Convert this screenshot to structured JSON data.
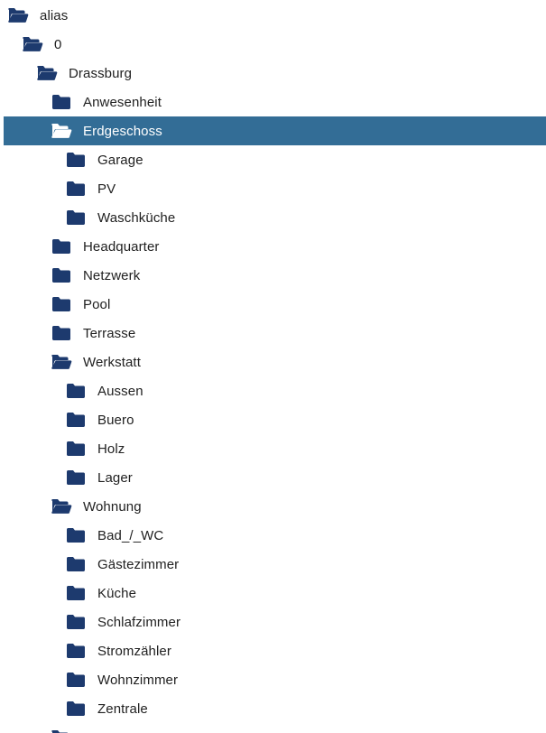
{
  "colors": {
    "folder_icon": "#1d3a6e",
    "selected_background": "#336d96",
    "selected_text": "#ffffff",
    "text": "#212121"
  },
  "tree": {
    "nodes": [
      {
        "label": "alias",
        "depth": 0,
        "state": "open",
        "icon": "folder-open-icon",
        "selected": false
      },
      {
        "label": "0",
        "depth": 1,
        "state": "open",
        "icon": "folder-open-icon",
        "selected": false
      },
      {
        "label": "Drassburg",
        "depth": 2,
        "state": "open",
        "icon": "folder-open-icon",
        "selected": false
      },
      {
        "label": "Anwesenheit",
        "depth": 3,
        "state": "closed",
        "icon": "folder-icon",
        "selected": false
      },
      {
        "label": "Erdgeschoss",
        "depth": 3,
        "state": "open",
        "icon": "folder-open-icon",
        "selected": true
      },
      {
        "label": "Garage",
        "depth": 4,
        "state": "closed",
        "icon": "folder-icon",
        "selected": false
      },
      {
        "label": "PV",
        "depth": 4,
        "state": "closed",
        "icon": "folder-icon",
        "selected": false
      },
      {
        "label": "Waschküche",
        "depth": 4,
        "state": "closed",
        "icon": "folder-icon",
        "selected": false
      },
      {
        "label": "Headquarter",
        "depth": 3,
        "state": "closed",
        "icon": "folder-icon",
        "selected": false
      },
      {
        "label": "Netzwerk",
        "depth": 3,
        "state": "closed",
        "icon": "folder-icon",
        "selected": false
      },
      {
        "label": "Pool",
        "depth": 3,
        "state": "closed",
        "icon": "folder-icon",
        "selected": false
      },
      {
        "label": "Terrasse",
        "depth": 3,
        "state": "closed",
        "icon": "folder-icon",
        "selected": false
      },
      {
        "label": "Werkstatt",
        "depth": 3,
        "state": "open",
        "icon": "folder-open-icon",
        "selected": false
      },
      {
        "label": "Aussen",
        "depth": 4,
        "state": "closed",
        "icon": "folder-icon",
        "selected": false
      },
      {
        "label": "Buero",
        "depth": 4,
        "state": "closed",
        "icon": "folder-icon",
        "selected": false
      },
      {
        "label": "Holz",
        "depth": 4,
        "state": "closed",
        "icon": "folder-icon",
        "selected": false
      },
      {
        "label": "Lager",
        "depth": 4,
        "state": "closed",
        "icon": "folder-icon",
        "selected": false
      },
      {
        "label": "Wohnung",
        "depth": 3,
        "state": "open",
        "icon": "folder-open-icon",
        "selected": false
      },
      {
        "label": "Bad_/_WC",
        "depth": 4,
        "state": "closed",
        "icon": "folder-icon",
        "selected": false
      },
      {
        "label": "Gästezimmer",
        "depth": 4,
        "state": "closed",
        "icon": "folder-icon",
        "selected": false
      },
      {
        "label": "Küche",
        "depth": 4,
        "state": "closed",
        "icon": "folder-icon",
        "selected": false
      },
      {
        "label": "Schlafzimmer",
        "depth": 4,
        "state": "closed",
        "icon": "folder-icon",
        "selected": false
      },
      {
        "label": "Stromzähler",
        "depth": 4,
        "state": "closed",
        "icon": "folder-icon",
        "selected": false
      },
      {
        "label": "Wohnzimmer",
        "depth": 4,
        "state": "closed",
        "icon": "folder-icon",
        "selected": false
      },
      {
        "label": "Zentrale",
        "depth": 4,
        "state": "closed",
        "icon": "folder-icon",
        "selected": false
      },
      {
        "label": "",
        "depth": 3,
        "state": "open",
        "icon": "folder-open-icon",
        "selected": false
      }
    ]
  }
}
